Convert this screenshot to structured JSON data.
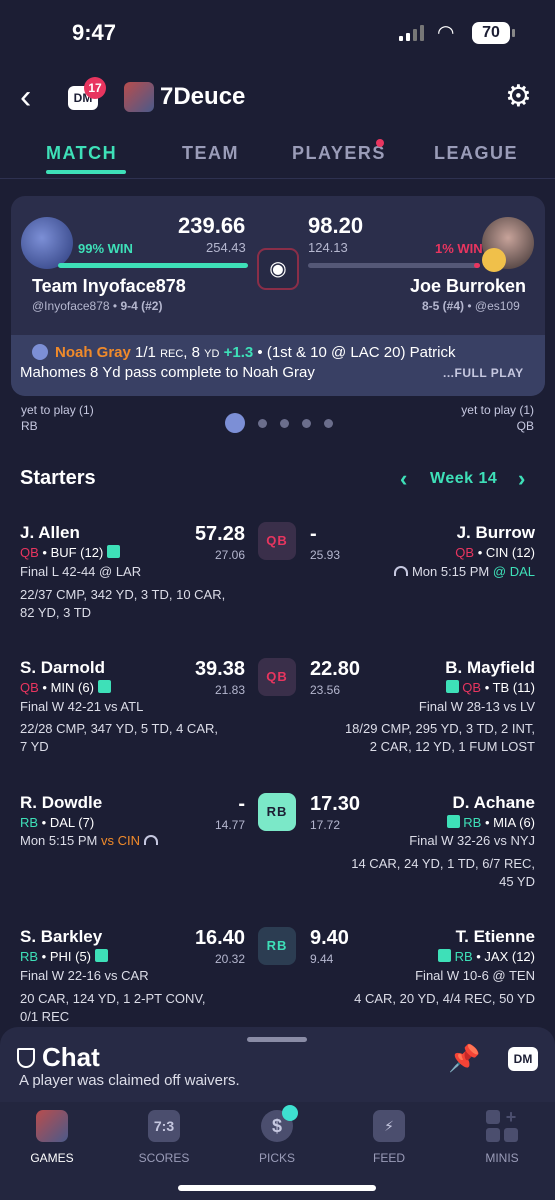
{
  "status_bar": {
    "time": "9:47",
    "battery": "70"
  },
  "header": {
    "dm_label": "DM",
    "dm_badge": "17",
    "league_name": "7Deuce"
  },
  "tabs": [
    {
      "label": "MATCH"
    },
    {
      "label": "TEAM"
    },
    {
      "label": "PLAYERS"
    },
    {
      "label": "LEAGUE"
    }
  ],
  "matchup": {
    "left": {
      "score": "239.66",
      "projected": "254.43",
      "win_pct": "99% WIN",
      "win_fraction": 0.99,
      "team": "Team Inyoface878",
      "handle": "@Inyoface878",
      "record": "9-4 (#2)"
    },
    "right": {
      "score": "98.20",
      "projected": "124.13",
      "win_pct": "1% WIN",
      "win_fraction": 0.01,
      "team": "Joe Burroken",
      "record": "8-5 (#4)",
      "handle": "@es109"
    },
    "play": {
      "player": "Noah Gray",
      "stat_a": "1/1",
      "stat_a_unit": "REC",
      "stat_b": ", 8",
      "stat_b_unit": "YD",
      "points": "+1.3",
      "desc1": " • (1st & 10 @ LAC 20) Patrick",
      "desc2": "Mahomes 8 Yd pass complete to Noah Gray",
      "full_play": "...FULL PLAY"
    },
    "yet_to_play_left": {
      "label": "yet to play (1)",
      "pos": "RB"
    },
    "yet_to_play_right": {
      "label": "yet to play (1)",
      "pos": "QB"
    }
  },
  "starters": {
    "title": "Starters",
    "week": "Week 14",
    "rows": [
      {
        "slot": "QB",
        "left": {
          "name": "J. Allen",
          "pos": "QB",
          "team": " • BUF (12)",
          "score": "57.28",
          "proj": "27.06",
          "status": "Final L 42-44 @ LAR",
          "stats1": "22/37 CMP, 342 YD, 3 TD, 10 CAR,",
          "stats2": "82 YD, 3 TD"
        },
        "right": {
          "name": "J. Burrow",
          "pos": "QB",
          "team": " • CIN (12)",
          "score": "-",
          "proj": "25.93",
          "status": "Mon 5:15 PM",
          "status_hl": "@ DAL"
        }
      },
      {
        "slot": "QB",
        "left": {
          "name": "S. Darnold",
          "pos": "QB",
          "team": " • MIN (6)",
          "score": "39.38",
          "proj": "21.83",
          "status": "Final W 42-21 vs ATL",
          "stats1": "22/28 CMP, 347 YD, 5 TD, 4 CAR,",
          "stats2": "7 YD"
        },
        "right": {
          "name": "B. Mayfield",
          "pos": "QB",
          "team": " • TB (11)",
          "score": "22.80",
          "proj": "23.56",
          "status": "Final W 28-13 vs LV",
          "stats1": "18/29 CMP, 295 YD, 3 TD, 2 INT,",
          "stats2": "2 CAR, 12 YD, 1 FUM LOST"
        }
      },
      {
        "slot": "RB",
        "left": {
          "name": "R. Dowdle",
          "pos": "RB",
          "team": " • DAL (7)",
          "score": "-",
          "proj": "14.77",
          "status": "Mon 5:15 PM",
          "status_hl": "vs CIN"
        },
        "right": {
          "name": "D. Achane",
          "pos": "RB",
          "team": " • MIA (6)",
          "score": "17.30",
          "proj": "17.72",
          "status": "Final W 32-26 vs NYJ",
          "stats1": "14 CAR, 24 YD, 1 TD, 6/7 REC,",
          "stats2": "45 YD"
        }
      },
      {
        "slot": "RB",
        "left": {
          "name": "S. Barkley",
          "pos": "RB",
          "team": " • PHI (5)",
          "score": "16.40",
          "proj": "20.32",
          "status": "Final W 22-16 vs CAR",
          "stats1": "20 CAR, 124 YD, 1 2-PT CONV,",
          "stats2": "0/1 REC"
        },
        "right": {
          "name": "T. Etienne",
          "pos": "RB",
          "team": " • JAX (12)",
          "score": "9.40",
          "proj": "9.44",
          "status": "Final W 10-6 @ TEN",
          "stats1": "4 CAR, 20 YD, 4/4 REC, 50 YD"
        }
      }
    ]
  },
  "chat": {
    "title": "Chat",
    "subtitle": "A player was claimed off waivers.",
    "dm_label": "DM"
  },
  "nav": [
    {
      "label": "GAMES"
    },
    {
      "label": "SCORES",
      "icon_text": "7:3"
    },
    {
      "label": "PICKS",
      "icon_text": "$"
    },
    {
      "label": "FEED",
      "icon_text": "⚡"
    },
    {
      "label": "MINIS"
    }
  ]
}
